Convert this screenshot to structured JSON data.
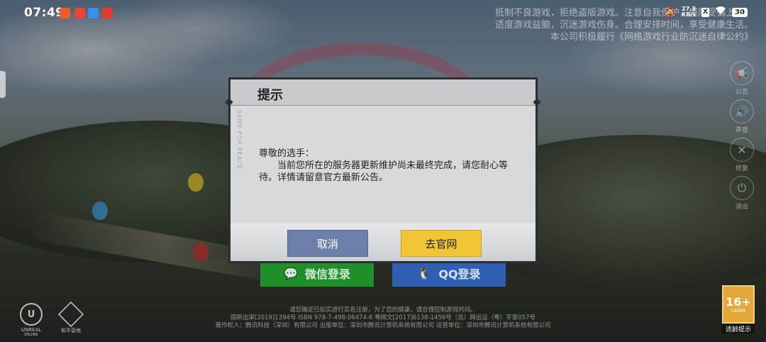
{
  "status_bar": {
    "time": "07:49",
    "net_speed_value": "27.3",
    "net_speed_unit": "KB/s",
    "battery": "30",
    "sim": "X",
    "notification_colors": [
      "#f15a2b",
      "#e8443a",
      "#3b8fe6",
      "#e33b2e"
    ]
  },
  "notice": {
    "line1": "抵制不良游戏，拒绝盗版游戏。注意自我保护，谨防受骗上当。",
    "line2": "适度游戏益脑，沉迷游戏伤身。合理安排时间，享受健康生活。",
    "line3": "本公司积极履行《网络游戏行业防沉迷自律公约》"
  },
  "side_menu": [
    {
      "icon": "megaphone-icon",
      "glyph": "📢",
      "label": "公告"
    },
    {
      "icon": "speaker-icon",
      "glyph": "🔊",
      "label": "声音"
    },
    {
      "icon": "repair-icon",
      "glyph": "✕",
      "label": "修复"
    },
    {
      "icon": "power-icon",
      "glyph": "⏻",
      "label": "退出"
    }
  ],
  "login": {
    "wechat_label": "微信登录",
    "qq_label": "QQ登录"
  },
  "dialog": {
    "title": "提示",
    "greeting": "尊敬的选手：",
    "message": "当前您所在的服务器更新维护尚未最终完成，请您耐心等待。详情请留意官方最新公告。",
    "side_watermark": "GAME FOR PEACE",
    "cancel_label": "取消",
    "confirm_label": "去官网"
  },
  "footer": {
    "line1": "请您确定已如实进行实名注册，为了您的健康，请合理控制游戏时间。",
    "line2": "国新出审[2019]1394号  ISBN 978-7-498-06474-6  粤网文[2017]6138-1456号（总）网出证（粤）字第057号",
    "line3": "著作权人：腾讯科技（深圳）有限公司  出版单位：深圳市腾讯计算机系统有限公司  运营单位：深圳市腾讯计算机系统有限公司"
  },
  "logos": {
    "unreal": "UNREAL",
    "unreal_sub": "ENGINE",
    "gp": "和平营地"
  },
  "age_rating": {
    "value": "16+",
    "sub": "CADPA",
    "label": "适龄提示"
  }
}
